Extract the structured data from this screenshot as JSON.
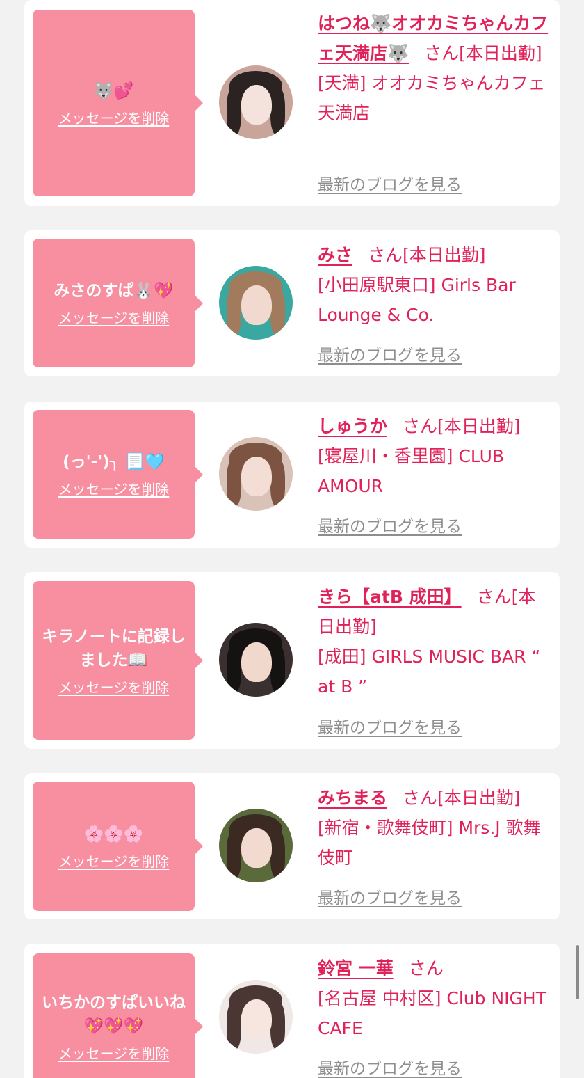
{
  "delete_label": "メッセージを削除",
  "blog_label": "最新のブログを見る",
  "san_label": "さん",
  "colors": {
    "accent": "#e0225a",
    "bubble": "#f88fa1",
    "background": "#f2f2f2",
    "link_gray": "#8e8e8e"
  },
  "entries": [
    {
      "message": "🐺💕",
      "name": "はつね🐺オオカミちゃんカフェ天満店🐺",
      "status": "[本日出勤]",
      "shop": "[天満] オオカミちゃんカフェ天満店"
    },
    {
      "message": "みさのすぱ🐰💖",
      "name": "みさ",
      "status": "[本日出勤]",
      "shop": "[小田原駅東口] Girls Bar Lounge & Co."
    },
    {
      "message": "(っ'-')╮ 📃🩵",
      "name": "しゅうか",
      "status": "[本日出勤]",
      "shop": "[寝屋川・香里園] CLUB AMOUR"
    },
    {
      "message": "キラノートに記録しました📖",
      "name": "きら【atB 成田】",
      "status": "[本日出勤]",
      "shop": "[成田] GIRLS MUSIC BAR “ at B ”"
    },
    {
      "message": "🌸🌸🌸",
      "name": "みちまる",
      "status": "[本日出勤]",
      "shop": "[新宿・歌舞伎町] Mrs.J 歌舞伎町"
    },
    {
      "message": "いちかのすぱいいね💖💖💖",
      "name": "鈴宮 一華",
      "status": "",
      "shop": "[名古屋 中村区] Club NIGHT CAFE"
    }
  ]
}
